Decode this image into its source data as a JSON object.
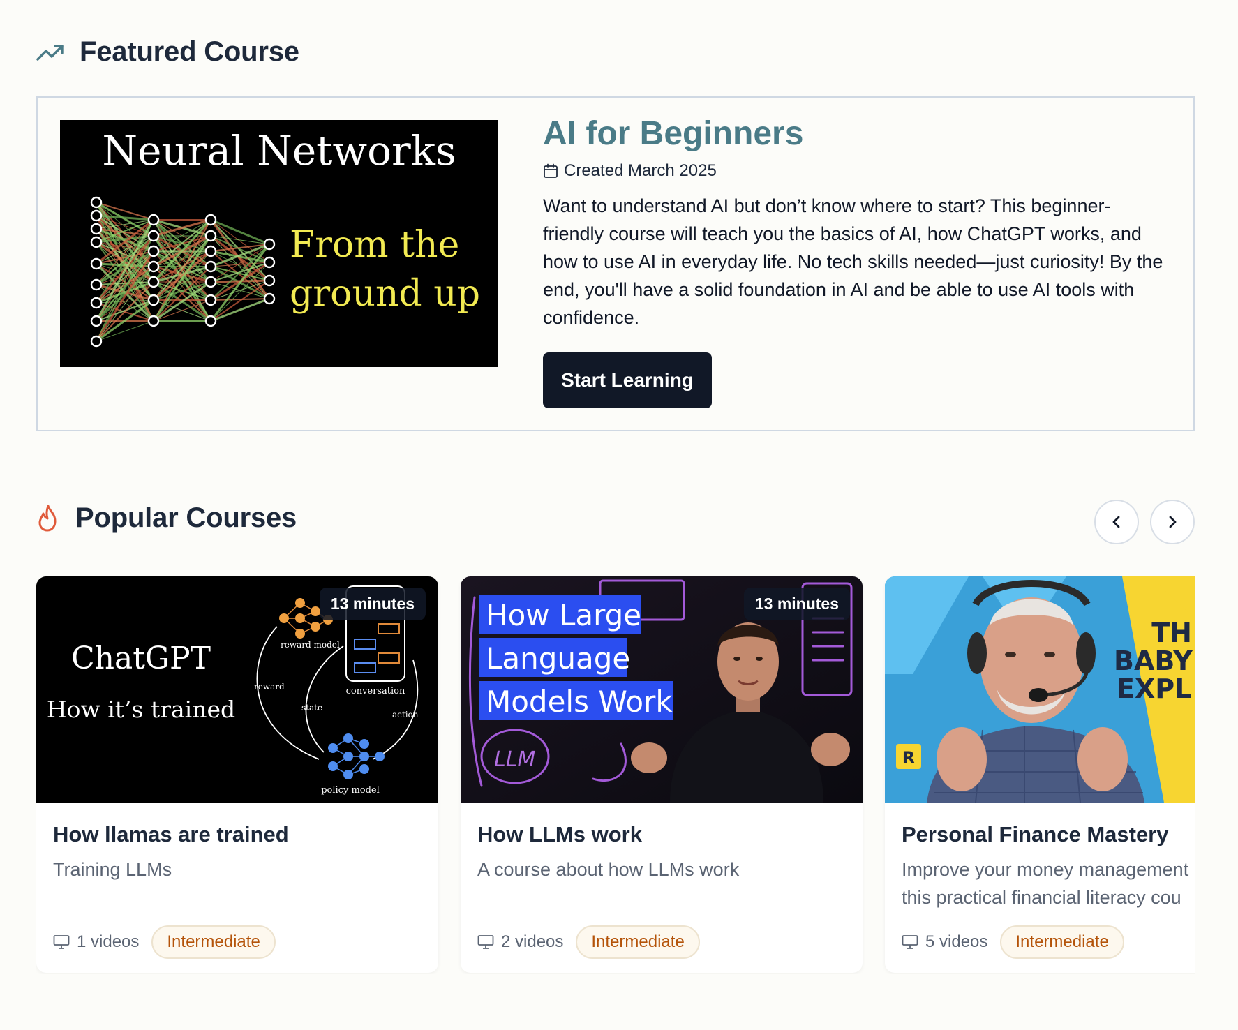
{
  "featured": {
    "section_title": "Featured Course",
    "section_icon": "trending-up-icon",
    "thumbnail": {
      "title": "Neural Networks",
      "subtitle_line1": "From the",
      "subtitle_line2": "ground up"
    },
    "title": "AI for Beginners",
    "created": "Created March 2025",
    "description": "Want to understand AI but don’t know where to start? This beginner-friendly course will teach you the basics of AI, how ChatGPT works, and how to use AI in everyday life. No tech skills needed—just curiosity! By the end, you'll have a solid foundation in AI and be able to use AI tools with confidence.",
    "button_label": "Start Learning"
  },
  "popular": {
    "section_title": "Popular Courses",
    "section_icon": "flame-icon",
    "prev_icon": "chevron-left-icon",
    "next_icon": "chevron-right-icon",
    "courses": [
      {
        "title": "How llamas are trained",
        "description": "Training LLMs",
        "videos": "1 videos",
        "level": "Intermediate",
        "duration": "13 minutes",
        "thumb": {
          "title": "ChatGPT",
          "subtitle": "How it’s trained",
          "label_reward_model": "reward model",
          "label_conversation": "conversation",
          "label_reward": "reward",
          "label_state": "state",
          "label_action": "action",
          "label_policy_model": "policy model"
        }
      },
      {
        "title": "How LLMs work",
        "description": "A course about how LLMs work",
        "videos": "2 videos",
        "level": "Intermediate",
        "duration": "13 minutes",
        "thumb": {
          "line1": "How Large",
          "line2": "Language",
          "line3": "Models Work",
          "scribble": "LLM"
        }
      },
      {
        "title": "Personal Finance Mastery",
        "description": "Improve your money management with this practical financial literacy course",
        "description_line1": "Improve your money management",
        "description_line2": "this practical financial literacy cou",
        "videos": "5 videos",
        "level": "Intermediate",
        "thumb": {
          "banner_line1": "TH",
          "banner_line2": "BABY",
          "banner_line3": "EXPL",
          "logo": "R"
        }
      }
    ]
  },
  "colors": {
    "accent": "#4a7b87",
    "button": "#111827",
    "badge_text": "#b45309",
    "flame": "#e05a3a"
  }
}
